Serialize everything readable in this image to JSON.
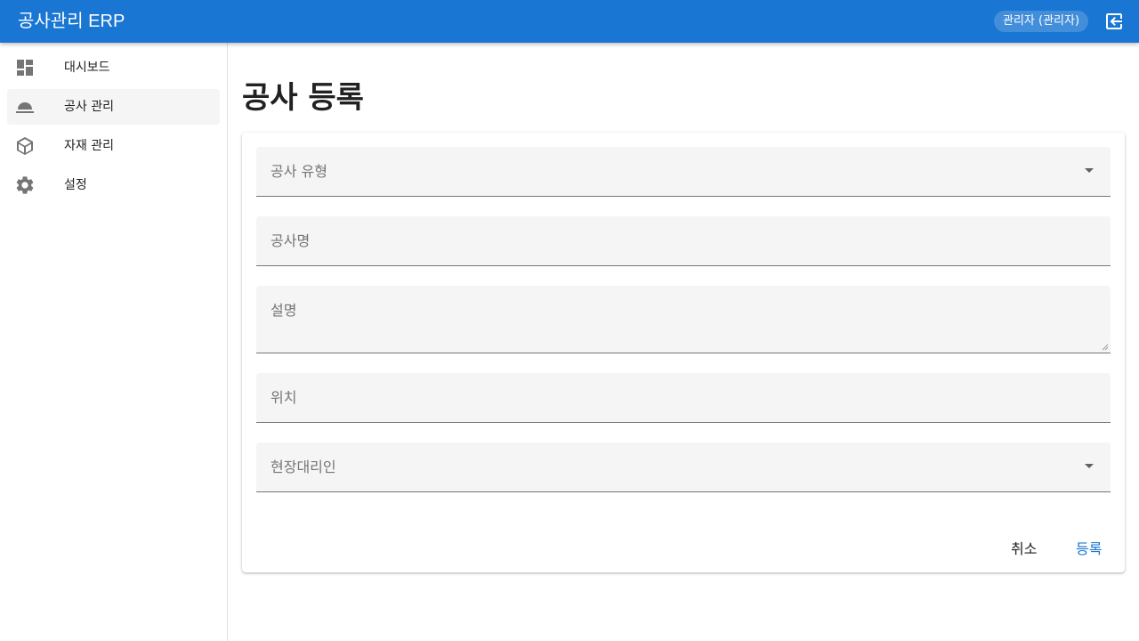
{
  "app": {
    "title": "공사관리 ERP",
    "user_label": "관리자 (관리자)",
    "logout_icon": "logout-icon"
  },
  "sidebar": {
    "items": [
      {
        "label": "대시보드",
        "icon": "dashboard-icon",
        "active": false
      },
      {
        "label": "공사 관리",
        "icon": "hardhat-icon",
        "active": true
      },
      {
        "label": "자재 관리",
        "icon": "package-icon",
        "active": false
      },
      {
        "label": "설정",
        "icon": "gear-icon",
        "active": false
      }
    ]
  },
  "page": {
    "title": "공사 등록"
  },
  "form": {
    "construction_type": {
      "label": "공사 유형",
      "value": ""
    },
    "construction_name": {
      "label": "공사명",
      "value": ""
    },
    "description": {
      "label": "설명",
      "value": ""
    },
    "location": {
      "label": "위치",
      "value": ""
    },
    "site_agent": {
      "label": "현장대리인",
      "value": ""
    },
    "cancel_label": "취소",
    "submit_label": "등록"
  },
  "colors": {
    "primary": "#1976d2",
    "field_bg": "#f5f5f5",
    "label_gray": "#757575"
  }
}
